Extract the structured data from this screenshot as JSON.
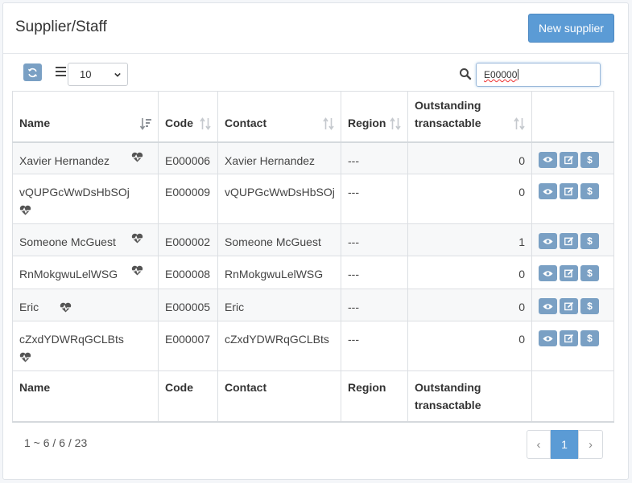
{
  "header": {
    "title": "Supplier/Staff",
    "new_button": "New supplier"
  },
  "toolbar": {
    "page_size": "10",
    "search_value": "E00000"
  },
  "table": {
    "columns": [
      "Name",
      "Code",
      "Contact",
      "Region",
      "Outstanding transactable",
      ""
    ],
    "rows": [
      {
        "name": "Xavier Hernandez",
        "code": "E000006",
        "contact": "Xavier Hernandez",
        "region": "---",
        "outstanding": "0"
      },
      {
        "name": "vQUPGcWwDsHbSOj",
        "code": "E000009",
        "contact": "vQUPGcWwDsHbSOj",
        "region": "---",
        "outstanding": "0"
      },
      {
        "name": "Someone McGuest",
        "code": "E000002",
        "contact": "Someone McGuest",
        "region": "---",
        "outstanding": "1"
      },
      {
        "name": "RnMokgwuLelWSG",
        "code": "E000008",
        "contact": "RnMokgwuLelWSG",
        "region": "---",
        "outstanding": "0"
      },
      {
        "name": "Eric",
        "code": "E000005",
        "contact": "Eric",
        "region": "---",
        "outstanding": "0"
      },
      {
        "name": "cZxdYDWRqGCLBts",
        "code": "E000007",
        "contact": "cZxdYDWRqGCLBts",
        "region": "---",
        "outstanding": "0"
      }
    ],
    "footer_columns": [
      "Name",
      "Code",
      "Contact",
      "Region",
      "Outstanding transactable",
      ""
    ]
  },
  "footer": {
    "info": "1 ~ 6 / 6 / 23",
    "pager": {
      "prev": "‹",
      "current": "1",
      "next": "›"
    }
  },
  "colors": {
    "primary": "#5b9bd5",
    "action": "#7aa0c4"
  },
  "icons": {
    "refresh": "refresh-icon",
    "menu": "list-icon",
    "search": "search-icon",
    "heart": "heartbeat-icon",
    "view": "eye-icon",
    "edit": "edit-icon",
    "pay": "dollar-icon"
  }
}
